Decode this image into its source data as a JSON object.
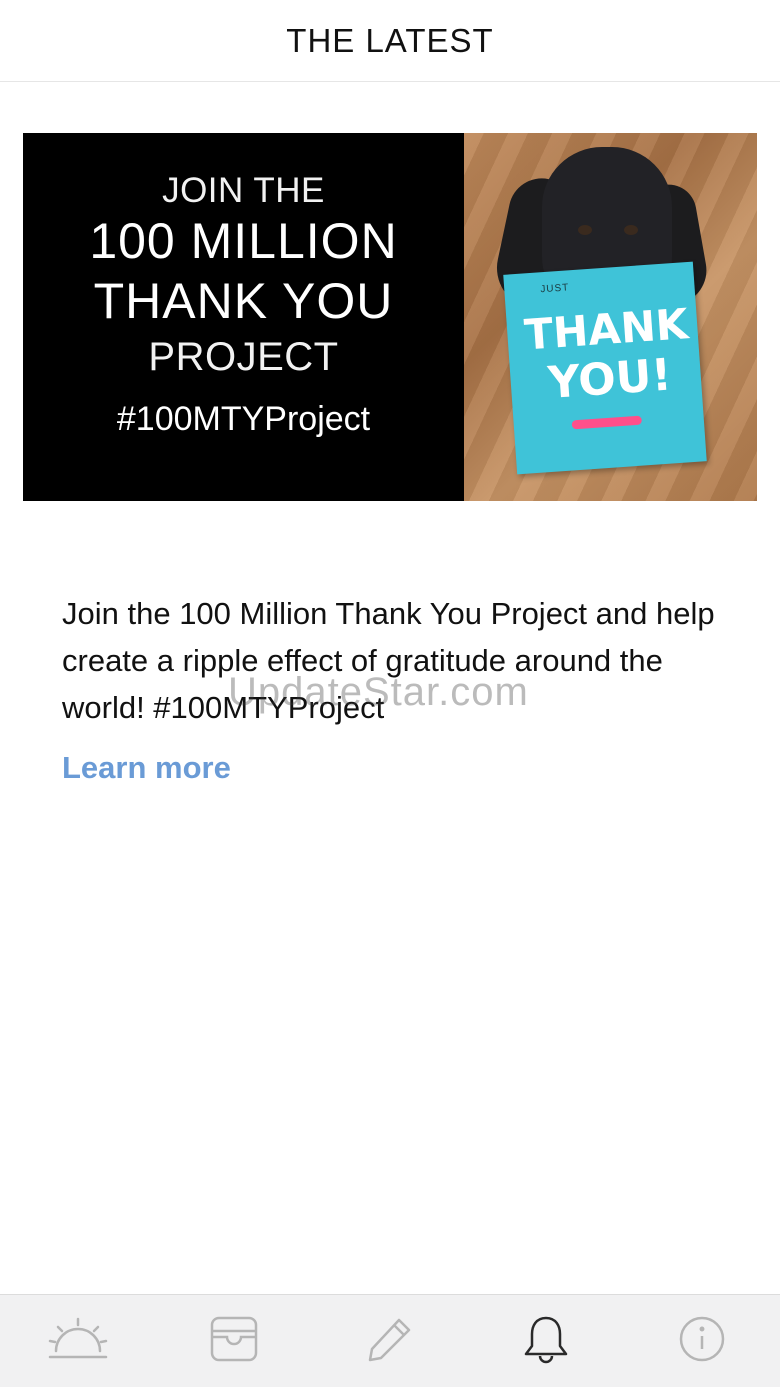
{
  "header": {
    "title": "THE LATEST"
  },
  "banner": {
    "line1": "JOIN THE",
    "line2": "100 MILLION",
    "line3": "THANK YOU",
    "line4": "PROJECT",
    "hashtag": "#100MTYProject",
    "card": {
      "small": "JUST",
      "thank": "THANK",
      "you": "YOU!"
    }
  },
  "post": {
    "description": "Join the 100 Million Thank You Project and help create a ripple effect of gratitude around the world! #100MTYProject",
    "learn_more": "Learn more"
  },
  "watermark": "UpdateStar.com",
  "tabbar": {
    "tabs": [
      {
        "icon": "sunrise-icon",
        "active": false
      },
      {
        "icon": "wallet-icon",
        "active": false
      },
      {
        "icon": "pencil-icon",
        "active": false
      },
      {
        "icon": "bell-icon",
        "active": true
      },
      {
        "icon": "info-icon",
        "active": false
      }
    ]
  },
  "colors": {
    "link": "#6a9bd6",
    "tab_inactive": "#b5b5b5",
    "tab_active": "#2a2a2a",
    "card": "#3fc3d8"
  }
}
